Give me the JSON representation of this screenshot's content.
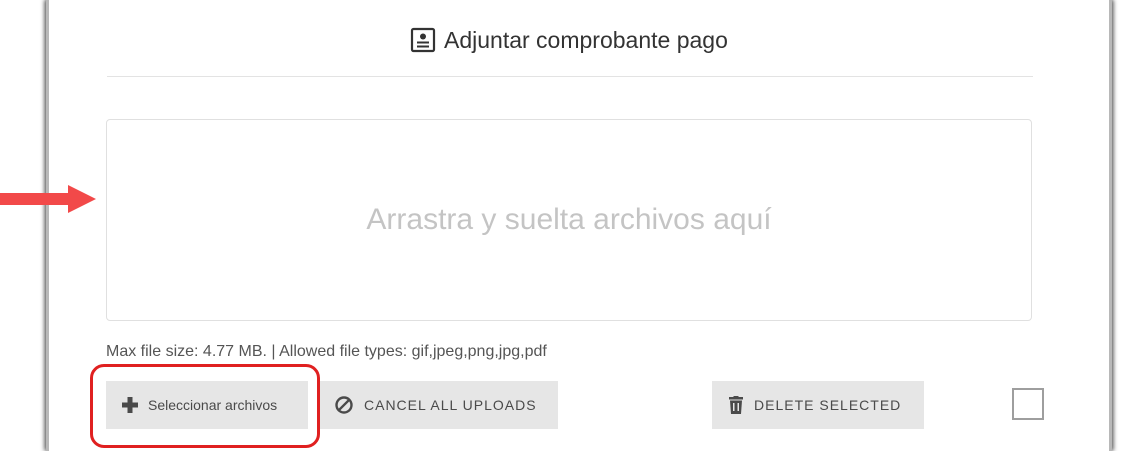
{
  "header": {
    "title": "Adjuntar comprobante pago",
    "icon": "document-icon"
  },
  "dropzone": {
    "text": "Arrastra y suelta archivos aquí"
  },
  "info": {
    "text": "Max file size: 4.77 MB. | Allowed file types: gif,jpeg,png,jpg,pdf"
  },
  "buttons": {
    "select_label": "Seleccionar archivos",
    "cancel_label": "CANCEL ALL UPLOADS",
    "delete_label": "DELETE SELECTED"
  },
  "colors": {
    "annotation_red": "#e02020",
    "arrow_red": "#f24949",
    "button_bg": "#e6e6e6",
    "placeholder_text": "#c4c4c4"
  }
}
